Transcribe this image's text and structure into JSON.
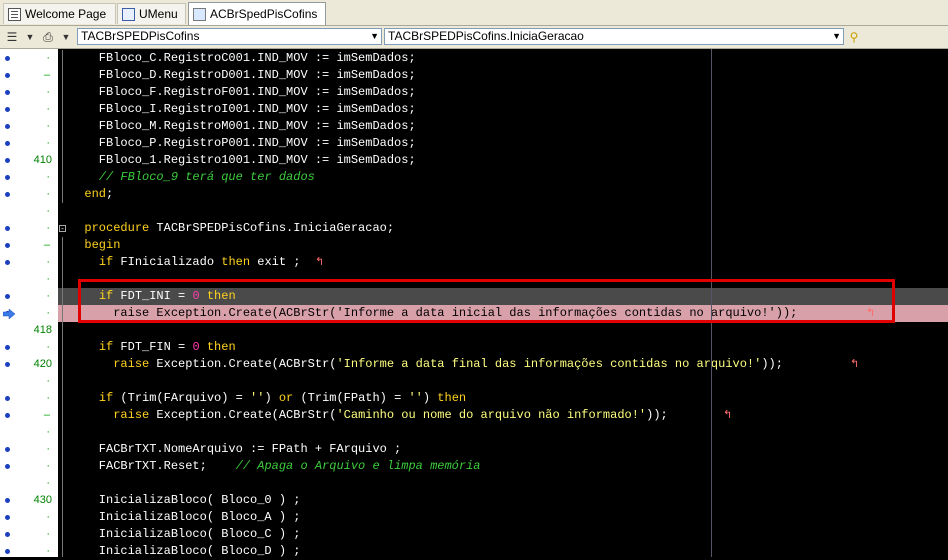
{
  "tabs": [
    {
      "label": "Welcome Page",
      "icon": "document-icon"
    },
    {
      "label": "UMenu",
      "icon": "unit-icon"
    },
    {
      "label": "ACBrSpedPisCofins",
      "icon": "form-icon"
    }
  ],
  "toolbar": {
    "class_combo": "TACBrSPEDPisCofins",
    "method_combo": "TACBrSPEDPisCofins.IniciaGeracao",
    "search_icon": "magnifier-icon"
  },
  "gutter": {
    "line_numbers": {
      "6": "410",
      "16": "418",
      "18": "420",
      "26": "430"
    }
  },
  "code_lines": [
    "    FBloco_C.RegistroC001.IND_MOV := imSemDados;",
    "    FBloco_D.RegistroD001.IND_MOV := imSemDados;",
    "    FBloco_F.RegistroF001.IND_MOV := imSemDados;",
    "    FBloco_I.RegistroI001.IND_MOV := imSemDados;",
    "    FBloco_M.RegistroM001.IND_MOV := imSemDados;",
    "    FBloco_P.RegistroP001.IND_MOV := imSemDados;",
    "    FBloco_1.Registro1001.IND_MOV := imSemDados;",
    "    // FBloco_9 terá que ter dados",
    "  end;",
    "",
    "  procedure TACBrSPEDPisCofins.IniciaGeracao;",
    "  begin",
    "    if FInicializado then exit ;",
    "",
    "    if FDT_INI = 0 then",
    "      raise Exception.Create(ACBrStr('Informe a data inicial das informações contidas no arquivo!'));",
    "",
    "    if FDT_FIN = 0 then",
    "      raise Exception.Create(ACBrStr('Informe a data final das informações contidas no arquivo!'));",
    "",
    "    if (Trim(FArquivo) = '') or (Trim(FPath) = '') then",
    "      raise Exception.Create(ACBrStr('Caminho ou nome do arquivo não informado!'));",
    "",
    "    FACBrTXT.NomeArquivo := FPath + FArquivo ;",
    "    FACBrTXT.Reset;    // Apaga o Arquivo e limpa memória",
    "",
    "    InicializaBloco( Bloco_0 ) ;",
    "    InicializaBloco( Bloco_A ) ;",
    "    InicializaBloco( Bloco_C ) ;",
    "    InicializaBloco( Bloco_D ) ;"
  ]
}
